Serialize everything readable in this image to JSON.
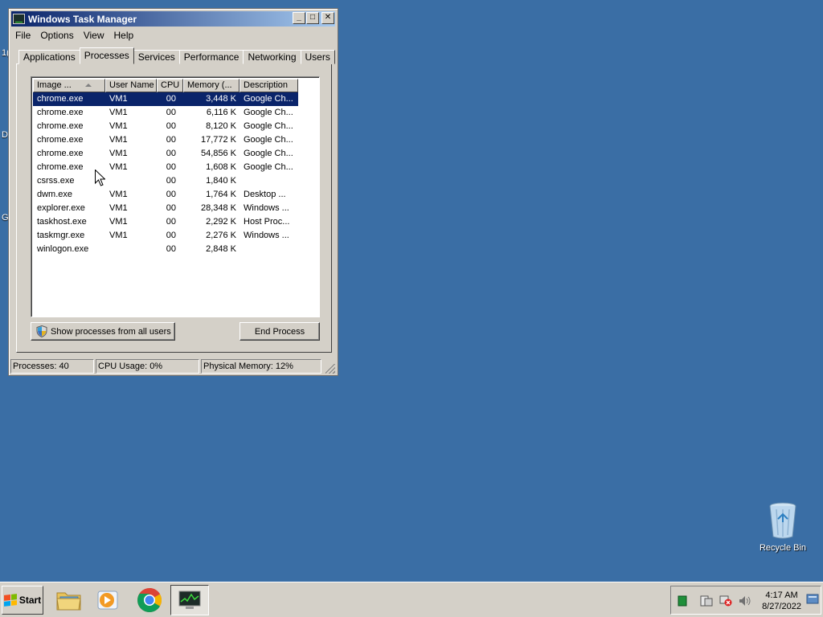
{
  "desktop": {
    "cut_labels": [
      "1(",
      "D",
      "G"
    ],
    "recycle_bin_label": "Recycle Bin"
  },
  "window": {
    "title": "Windows Task Manager",
    "controls": {
      "minimize": "_",
      "maximize": "□",
      "close": "✕"
    },
    "menu": [
      "File",
      "Options",
      "View",
      "Help"
    ],
    "tabs": [
      "Applications",
      "Processes",
      "Services",
      "Performance",
      "Networking",
      "Users"
    ],
    "active_tab": "Processes",
    "columns": [
      "Image ...",
      "User Name",
      "CPU",
      "Memory (...",
      "Description"
    ],
    "processes": [
      {
        "image": "chrome.exe",
        "user": "VM1",
        "cpu": "00",
        "memory": "3,448 K",
        "description": "Google Ch..."
      },
      {
        "image": "chrome.exe",
        "user": "VM1",
        "cpu": "00",
        "memory": "6,116 K",
        "description": "Google Ch..."
      },
      {
        "image": "chrome.exe",
        "user": "VM1",
        "cpu": "00",
        "memory": "8,120 K",
        "description": "Google Ch..."
      },
      {
        "image": "chrome.exe",
        "user": "VM1",
        "cpu": "00",
        "memory": "17,772 K",
        "description": "Google Ch..."
      },
      {
        "image": "chrome.exe",
        "user": "VM1",
        "cpu": "00",
        "memory": "54,856 K",
        "description": "Google Ch..."
      },
      {
        "image": "chrome.exe",
        "user": "VM1",
        "cpu": "00",
        "memory": "1,608 K",
        "description": "Google Ch..."
      },
      {
        "image": "csrss.exe",
        "user": "",
        "cpu": "00",
        "memory": "1,840 K",
        "description": ""
      },
      {
        "image": "dwm.exe",
        "user": "VM1",
        "cpu": "00",
        "memory": "1,764 K",
        "description": "Desktop ..."
      },
      {
        "image": "explorer.exe",
        "user": "VM1",
        "cpu": "00",
        "memory": "28,348 K",
        "description": "Windows ..."
      },
      {
        "image": "taskhost.exe",
        "user": "VM1",
        "cpu": "00",
        "memory": "2,292 K",
        "description": "Host Proc..."
      },
      {
        "image": "taskmgr.exe",
        "user": "VM1",
        "cpu": "00",
        "memory": "2,276 K",
        "description": "Windows ..."
      },
      {
        "image": "winlogon.exe",
        "user": "",
        "cpu": "00",
        "memory": "2,848 K",
        "description": ""
      }
    ],
    "buttons": {
      "show_all": "Show processes from all users",
      "end_process": "End Process"
    },
    "status": {
      "processes": "Processes: 40",
      "cpu": "CPU Usage: 0%",
      "memory": "Physical Memory: 12%"
    }
  },
  "taskbar": {
    "start_label": "Start",
    "clock_time": "4:17 AM",
    "clock_date": "8/27/2022"
  },
  "colors": {
    "desktop": "#3a6ea5",
    "selection": "#0a246a",
    "title_start": "#0a246a",
    "title_end": "#a6caf0"
  }
}
